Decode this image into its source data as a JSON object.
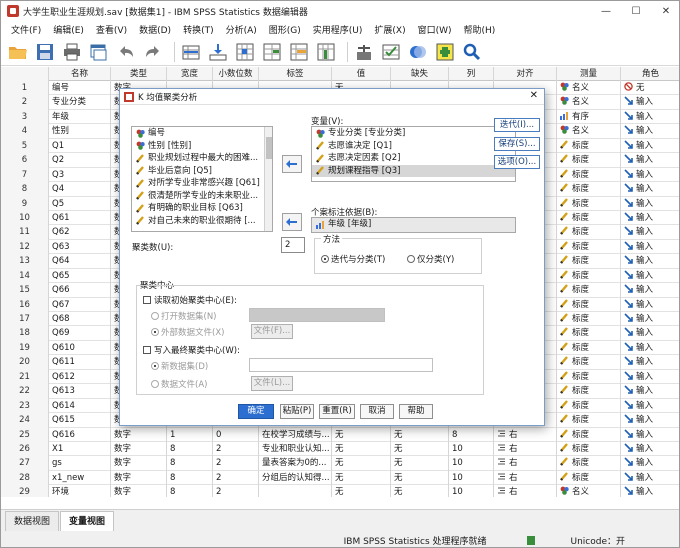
{
  "window": {
    "title": "大学生职业生涯规划.sav [数据集1] - IBM SPSS Statistics 数据编辑器",
    "controls": [
      "—",
      "☐",
      "✕"
    ]
  },
  "menu": [
    "文件(F)",
    "编辑(E)",
    "查看(V)",
    "数据(D)",
    "转换(T)",
    "分析(A)",
    "图形(G)",
    "实用程序(U)",
    "扩展(X)",
    "窗口(W)",
    "帮助(H)"
  ],
  "toolbar_icons": [
    "open-folder-icon",
    "save-icon",
    "print-icon",
    "recall-dialog-icon",
    "undo-icon",
    "redo-icon",
    "goto-case-icon",
    "goto-variable-icon",
    "variables-icon",
    "split-file-icon",
    "insert-case-icon",
    "insert-variable-icon",
    "weight-cases-icon",
    "select-cases-icon",
    "value-labels-icon",
    "use-sets-icon",
    "spell-check-icon",
    "search-icon"
  ],
  "grid": {
    "headers": [
      "名称",
      "类型",
      "宽度",
      "小数位数",
      "标签",
      "值",
      "缺失",
      "列",
      "对齐",
      "测量",
      "角色"
    ],
    "rows": [
      {
        "n": "1",
        "name": "编号",
        "type": "数字",
        "width": "",
        "dec": "",
        "label": "",
        "vals": "无",
        "miss": "",
        "col": "",
        "align": "",
        "meas": "名义",
        "role": "无"
      },
      {
        "n": "2",
        "name": "专业分类",
        "type": "数字",
        "width": "",
        "dec": "",
        "label": "",
        "vals": "",
        "miss": "",
        "col": "",
        "align": "",
        "meas": "名义",
        "role": "输入"
      },
      {
        "n": "3",
        "name": "年级",
        "type": "数字",
        "width": "",
        "dec": "",
        "label": "",
        "vals": "",
        "miss": "",
        "col": "",
        "align": "",
        "meas": "有序",
        "role": "输入"
      },
      {
        "n": "4",
        "name": "性别",
        "type": "数字",
        "width": "",
        "dec": "",
        "label": "",
        "vals": "",
        "miss": "",
        "col": "",
        "align": "",
        "meas": "名义",
        "role": "输入"
      },
      {
        "n": "5",
        "name": "Q1",
        "type": "数字",
        "width": "",
        "dec": "",
        "label": "",
        "vals": "",
        "miss": "",
        "col": "",
        "align": "",
        "meas": "标度",
        "role": "输入"
      },
      {
        "n": "6",
        "name": "Q2",
        "type": "数字",
        "width": "",
        "dec": "",
        "label": "",
        "vals": "",
        "miss": "",
        "col": "",
        "align": "",
        "meas": "标度",
        "role": "输入"
      },
      {
        "n": "7",
        "name": "Q3",
        "type": "数字",
        "width": "",
        "dec": "",
        "label": "",
        "vals": "",
        "miss": "",
        "col": "",
        "align": "",
        "meas": "标度",
        "role": "输入"
      },
      {
        "n": "8",
        "name": "Q4",
        "type": "数字",
        "width": "",
        "dec": "",
        "label": "",
        "vals": "",
        "miss": "",
        "col": "",
        "align": "",
        "meas": "标度",
        "role": "输入"
      },
      {
        "n": "9",
        "name": "Q5",
        "type": "数字",
        "width": "",
        "dec": "",
        "label": "",
        "vals": "",
        "miss": "",
        "col": "",
        "align": "",
        "meas": "标度",
        "role": "输入"
      },
      {
        "n": "10",
        "name": "Q61",
        "type": "数字",
        "width": "",
        "dec": "",
        "label": "",
        "vals": "",
        "miss": "",
        "col": "",
        "align": "",
        "meas": "标度",
        "role": "输入"
      },
      {
        "n": "11",
        "name": "Q62",
        "type": "数字",
        "width": "",
        "dec": "",
        "label": "",
        "vals": "",
        "miss": "",
        "col": "",
        "align": "",
        "meas": "标度",
        "role": "输入"
      },
      {
        "n": "12",
        "name": "Q63",
        "type": "数字",
        "width": "",
        "dec": "",
        "label": "",
        "vals": "",
        "miss": "",
        "col": "",
        "align": "",
        "meas": "标度",
        "role": "输入"
      },
      {
        "n": "13",
        "name": "Q64",
        "type": "数字",
        "width": "",
        "dec": "",
        "label": "",
        "vals": "",
        "miss": "",
        "col": "",
        "align": "",
        "meas": "标度",
        "role": "输入"
      },
      {
        "n": "14",
        "name": "Q65",
        "type": "数字",
        "width": "",
        "dec": "",
        "label": "",
        "vals": "",
        "miss": "",
        "col": "",
        "align": "",
        "meas": "标度",
        "role": "输入"
      },
      {
        "n": "15",
        "name": "Q66",
        "type": "数字",
        "width": "",
        "dec": "",
        "label": "",
        "vals": "",
        "miss": "",
        "col": "",
        "align": "",
        "meas": "标度",
        "role": "输入"
      },
      {
        "n": "16",
        "name": "Q67",
        "type": "数字",
        "width": "",
        "dec": "",
        "label": "",
        "vals": "",
        "miss": "",
        "col": "",
        "align": "",
        "meas": "标度",
        "role": "输入"
      },
      {
        "n": "17",
        "name": "Q68",
        "type": "数字",
        "width": "",
        "dec": "",
        "label": "",
        "vals": "",
        "miss": "",
        "col": "",
        "align": "",
        "meas": "标度",
        "role": "输入"
      },
      {
        "n": "18",
        "name": "Q69",
        "type": "数字",
        "width": "",
        "dec": "",
        "label": "",
        "vals": "",
        "miss": "",
        "col": "",
        "align": "",
        "meas": "标度",
        "role": "输入"
      },
      {
        "n": "19",
        "name": "Q610",
        "type": "数字",
        "width": "",
        "dec": "",
        "label": "",
        "vals": "",
        "miss": "",
        "col": "",
        "align": "",
        "meas": "标度",
        "role": "输入"
      },
      {
        "n": "20",
        "name": "Q611",
        "type": "数字",
        "width": "",
        "dec": "",
        "label": "",
        "vals": "",
        "miss": "",
        "col": "",
        "align": "",
        "meas": "标度",
        "role": "输入"
      },
      {
        "n": "21",
        "name": "Q612",
        "type": "数字",
        "width": "",
        "dec": "",
        "label": "",
        "vals": "",
        "miss": "",
        "col": "",
        "align": "",
        "meas": "标度",
        "role": "输入"
      },
      {
        "n": "22",
        "name": "Q613",
        "type": "数字",
        "width": "",
        "dec": "",
        "label": "",
        "vals": "",
        "miss": "",
        "col": "",
        "align": "",
        "meas": "标度",
        "role": "输入"
      },
      {
        "n": "23",
        "name": "Q614",
        "type": "数字",
        "width": "",
        "dec": "",
        "label": "",
        "vals": "",
        "miss": "",
        "col": "",
        "align": "",
        "meas": "标度",
        "role": "输入"
      },
      {
        "n": "24",
        "name": "Q615",
        "type": "数字",
        "width": "",
        "dec": "",
        "label": "",
        "vals": "",
        "miss": "",
        "col": "",
        "align": "",
        "meas": "标度",
        "role": "输入"
      },
      {
        "n": "25",
        "name": "Q616",
        "type": "数字",
        "width": "1",
        "dec": "0",
        "label": "在校学习成绩与...",
        "vals": "无",
        "miss": "无",
        "col": "8",
        "align": "右",
        "meas": "标度",
        "role": "输入"
      },
      {
        "n": "26",
        "name": "X1",
        "type": "数字",
        "width": "8",
        "dec": "2",
        "label": "专业和职业认知...",
        "vals": "无",
        "miss": "无",
        "col": "10",
        "align": "右",
        "meas": "标度",
        "role": "输入"
      },
      {
        "n": "27",
        "name": "gs",
        "type": "数字",
        "width": "8",
        "dec": "2",
        "label": "量表答案为0的...",
        "vals": "无",
        "miss": "无",
        "col": "10",
        "align": "右",
        "meas": "标度",
        "role": "输入"
      },
      {
        "n": "28",
        "name": "x1_new",
        "type": "数字",
        "width": "8",
        "dec": "2",
        "label": "分组后的认知得...",
        "vals": "无",
        "miss": "无",
        "col": "10",
        "align": "右",
        "meas": "标度",
        "role": "输入"
      },
      {
        "n": "29",
        "name": "环境",
        "type": "数字",
        "width": "8",
        "dec": "2",
        "label": "",
        "vals": "无",
        "miss": "无",
        "col": "10",
        "align": "右",
        "meas": "名义",
        "role": "输入"
      }
    ]
  },
  "tabs": {
    "data_view": "数据视图",
    "variable_view": "变量视图"
  },
  "status": {
    "processor": "IBM SPSS Statistics 处理程序就绪",
    "encoding": "Unicode：开"
  },
  "dialog": {
    "title": "K 均值聚类分析",
    "close": "✕",
    "source_vars": [
      {
        "label": "编号",
        "icon": "nominal"
      },
      {
        "label": "性别 [性别]",
        "icon": "nominal"
      },
      {
        "label": "职业规划过程中最大的困难...",
        "icon": "scale"
      },
      {
        "label": "毕业后意向 [Q5]",
        "icon": "scale"
      },
      {
        "label": "对所学专业非常感兴趣 [Q61]",
        "icon": "scale"
      },
      {
        "label": "很清楚所学专业的未来职业...",
        "icon": "scale"
      },
      {
        "label": "有明确的职业目标 [Q63]",
        "icon": "scale"
      },
      {
        "label": "对自己未来的职业很期待 [...",
        "icon": "scale"
      }
    ],
    "variables_label": "变量(V):",
    "variables": [
      {
        "label": "专业分类 [专业分类]",
        "icon": "nominal",
        "selected": false
      },
      {
        "label": "志愿谁决定 [Q1]",
        "icon": "scale",
        "selected": false
      },
      {
        "label": "志愿决定因素 [Q2]",
        "icon": "scale",
        "selected": false
      },
      {
        "label": "规划课程指导 [Q3]",
        "icon": "scale",
        "selected": true
      }
    ],
    "case_label_label": "个案标注依据(B):",
    "case_label_value": "年级 [年级]",
    "iterate_btn": "迭代(I)...",
    "save_btn": "保存(S)...",
    "options_btn": "选项(O)...",
    "clusters_label": "聚类数(U):",
    "clusters_value": "2",
    "method_label": "方法",
    "method_iter": "迭代与分类(T)",
    "method_classify": "仅分类(Y)",
    "centers_label": "聚类中心",
    "read_initial": "读取初始聚类中心(E):",
    "open_dataset": "打开数据集(N)",
    "external_file": "外部数据文件(X)",
    "file_btn": "文件(F)...",
    "write_final": "写入最终聚类中心(W):",
    "new_dataset": "新数据集(D)",
    "data_file": "数据文件(A)",
    "file_btn2": "文件(L)...",
    "ok": "确定",
    "paste": "粘贴(P)",
    "reset": "重置(R)",
    "cancel": "取消",
    "help": "帮助"
  },
  "colors": {
    "accent": "#2c6fd1",
    "nominal": "#c0392b",
    "ordinal": "#3a6fd8",
    "scale": "#d4a017",
    "role_input": "#1e5fb4"
  }
}
